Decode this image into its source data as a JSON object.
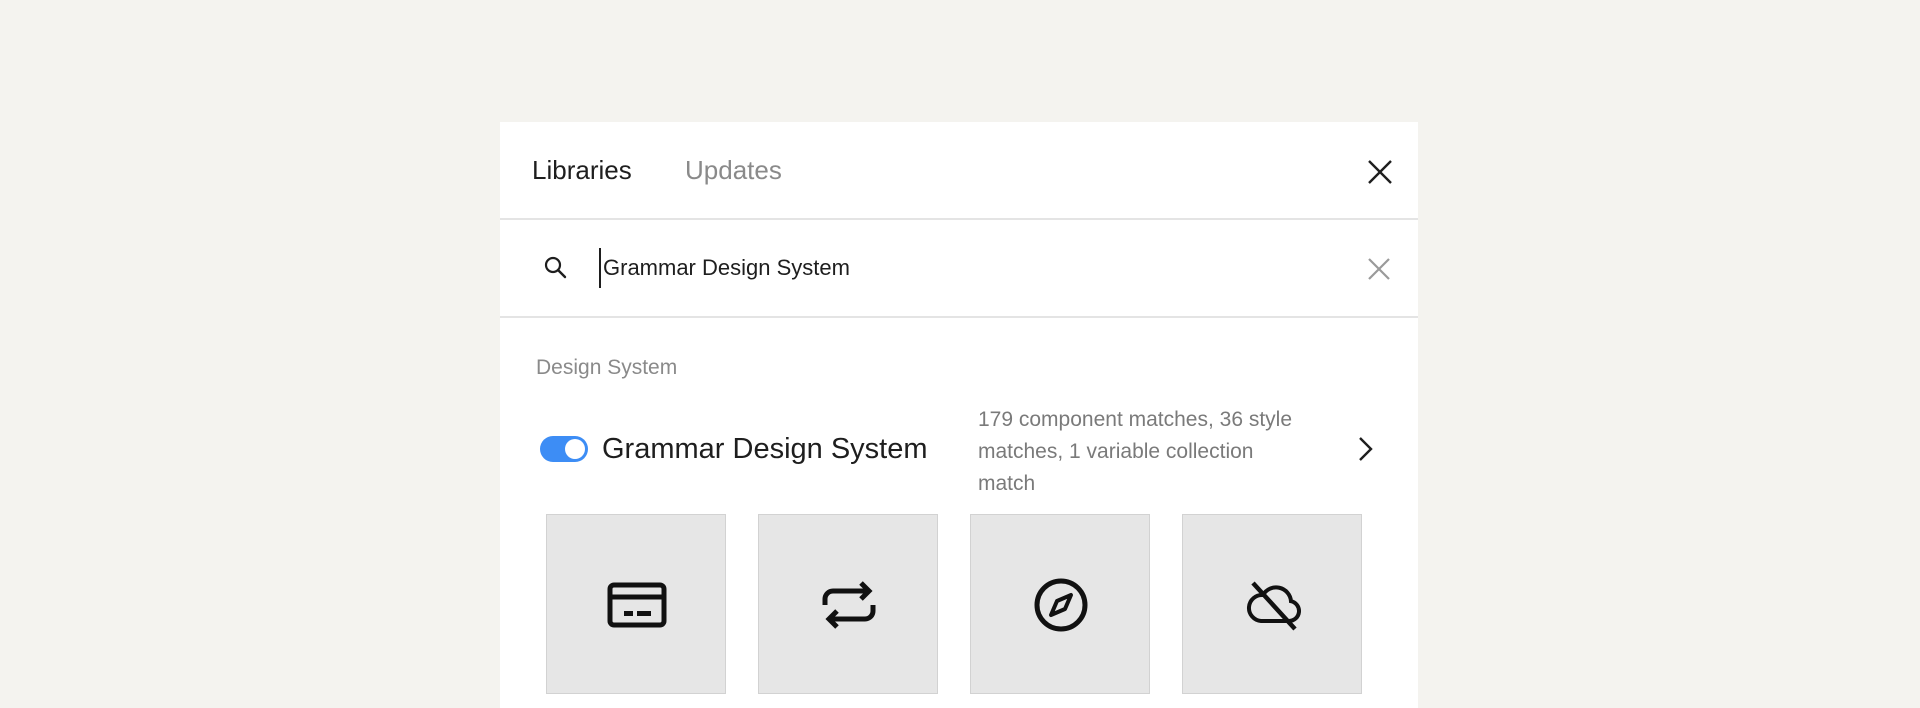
{
  "header": {
    "tabs": [
      {
        "label": "Libraries",
        "active": true
      },
      {
        "label": "Updates",
        "active": false
      }
    ],
    "close_icon": "close-icon"
  },
  "search": {
    "value": "Grammar Design System",
    "placeholder": "",
    "search_icon": "search-icon",
    "clear_icon": "clear-icon"
  },
  "section": {
    "label": "Design System"
  },
  "library": {
    "name": "Grammar Design System",
    "enabled": true,
    "matches": "179 component matches, 36 style matches, 1 variable collection match",
    "chevron_icon": "chevron-right-icon"
  },
  "tiles": [
    {
      "icon": "credit-card-icon"
    },
    {
      "icon": "repeat-icon"
    },
    {
      "icon": "compass-icon"
    },
    {
      "icon": "cloud-off-icon"
    }
  ],
  "colors": {
    "background": "#f4f3ef",
    "panel": "#ffffff",
    "toggle_on": "#3d8df5",
    "tile": "#e6e6e6",
    "muted_text": "#8a8a8a"
  }
}
